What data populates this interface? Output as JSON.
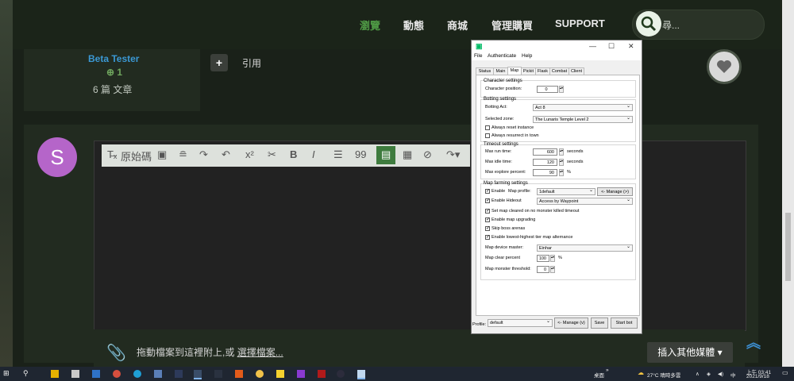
{
  "nav": {
    "items": [
      "瀏覽",
      "動態",
      "商城",
      "管理購買",
      "SUPPORT"
    ],
    "search_placeholder": "尋..."
  },
  "post": {
    "user_title": "Beta Tester",
    "reputation": "1",
    "post_count": "6 篇 文章",
    "quote_label": "引用"
  },
  "reply": {
    "avatar_letter": "S",
    "toolbar": {
      "source_label": "原始碼",
      "items": [
        "Tx",
        "x²",
        "B",
        "I",
        "¶",
        "99"
      ]
    },
    "drop_text": "拖動檔案到這裡附上,或",
    "choose_file": "選擇檔案...",
    "insert_media": "插入其他媒體"
  },
  "dialog": {
    "menu": [
      "File",
      "Authenticate",
      "Help"
    ],
    "tabs": [
      "Status",
      "Main",
      "Map",
      "Pickit",
      "Flask",
      "Combat",
      "Client"
    ],
    "active_tab": "Map",
    "character_settings": {
      "title": "Character settings",
      "position_label": "Character position:",
      "position_value": "0"
    },
    "botting_settings": {
      "title": "Botting settings",
      "act_label": "Botting Act:",
      "act_value": "Act 8",
      "zone_label": "Selected zone:",
      "zone_value": "The Lunaris Temple Level 2",
      "always_reset": "Always reset instance",
      "always_resurrect": "Always resurrect in town"
    },
    "timeout_settings": {
      "title": "Timeout settings",
      "run_label": "Max run time:",
      "run_value": "600",
      "run_unit": "seconds",
      "idle_label": "Max idle time:",
      "idle_value": "120",
      "idle_unit": "seconds",
      "explore_label": "Max explore percent:",
      "explore_value": "90",
      "explore_unit": "%"
    },
    "map_farming": {
      "title": "Map farming settings",
      "enable_label": "Enable",
      "profile_label": "Map profile:",
      "profile_value": "1default",
      "manage_label": "<- Manage (>)",
      "hideout_label": "Enable Hideout",
      "hideout_value": "Access by Waypoint",
      "set_cleared": "Set map cleared on no monster killed timeout",
      "upgrading": "Enable map upgrading",
      "skip_boss": "Skip boss arenas",
      "alternance": "Enable lowest-highest tier map alternance",
      "device_label": "Map device master:",
      "device_value": "Einhar",
      "clear_label": "Map clear percent",
      "clear_value": "100",
      "clear_unit": "%",
      "threshold_label": "Map monster threshold:",
      "threshold_value": "0"
    },
    "footer": {
      "profile_label": "Profile:",
      "profile_value": "default",
      "manage_label": "<- Manage (v)",
      "save_label": "Save",
      "start_label": "Start bot"
    }
  },
  "taskbar": {
    "desktop_label": "桌面",
    "weather": "27°C 晴時多雲",
    "time": "上午 03:41",
    "date": "2021/9/18"
  }
}
